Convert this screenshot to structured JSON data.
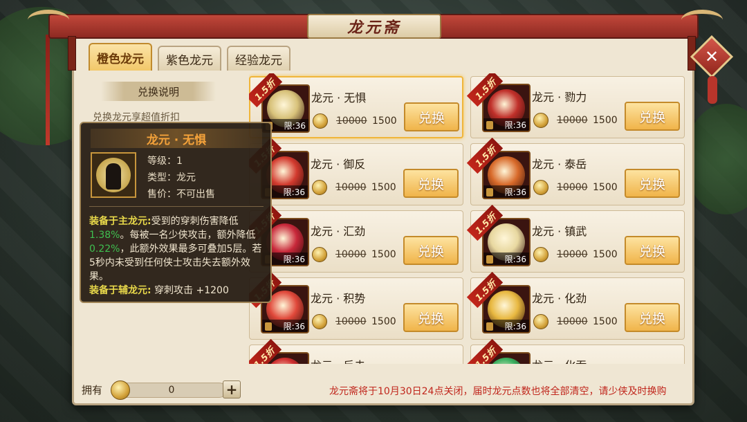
{
  "window": {
    "title": "龙元斋"
  },
  "tabs": [
    {
      "label": "橙色龙元",
      "active": true
    },
    {
      "label": "紫色龙元",
      "active": false
    },
    {
      "label": "经验龙元",
      "active": false
    }
  ],
  "explain": {
    "heading": "兑换说明",
    "text": "兑换龙元享超值折扣"
  },
  "items": [
    {
      "name": "龙元 · 无惧",
      "discount": "1.5折",
      "limit": "限:36",
      "orig_price": "10000",
      "price": "1500",
      "button": "兑换",
      "orb_color": "#d8c27a"
    },
    {
      "name": "龙元 · 勠力",
      "discount": "1.5折",
      "limit": "限:36",
      "orig_price": "10000",
      "price": "1500",
      "button": "兑换",
      "orb_color": "#c0302a"
    },
    {
      "name": "龙元 · 御反",
      "discount": "1.5折",
      "limit": "限:36",
      "orig_price": "10000",
      "price": "1500",
      "button": "兑换",
      "orb_color": "#d23a2e"
    },
    {
      "name": "龙元 · 泰岳",
      "discount": "1.5折",
      "limit": "限:36",
      "orig_price": "10000",
      "price": "1500",
      "button": "兑换",
      "orb_color": "#d86a2a"
    },
    {
      "name": "龙元 · 汇劲",
      "discount": "1.5折",
      "limit": "限:36",
      "orig_price": "10000",
      "price": "1500",
      "button": "兑换",
      "orb_color": "#c8283a"
    },
    {
      "name": "龙元 · 镇武",
      "discount": "1.5折",
      "limit": "限:36",
      "orig_price": "10000",
      "price": "1500",
      "button": "兑换",
      "orb_color": "#e8d8a0"
    },
    {
      "name": "龙元 · 积势",
      "discount": "1.5折",
      "limit": "限:36",
      "orig_price": "10000",
      "price": "1500",
      "button": "兑换",
      "orb_color": "#e0483a"
    },
    {
      "name": "龙元 · 化劲",
      "discount": "1.5折",
      "limit": "限:36",
      "orig_price": "10000",
      "price": "1500",
      "button": "兑换",
      "orb_color": "#e8b840"
    },
    {
      "name": "龙元 · 反击",
      "discount": "1.5折",
      "limit": "",
      "orig_price": "",
      "price": "",
      "button": "",
      "orb_color": "#d03030"
    },
    {
      "name": "龙元 · 化吞",
      "discount": "1.5折",
      "limit": "",
      "orig_price": "",
      "price": "",
      "button": "",
      "orb_color": "#3ab060"
    }
  ],
  "tooltip": {
    "title": "龙元 · 无惧",
    "level": "等级：1",
    "type": "类型：龙元",
    "sell": "售价：不可出售",
    "main_label": "装备于主龙元:",
    "main_text_1": "受到的穿刺伤害降低",
    "main_val_1": "1.38%",
    "main_text_2": "。每被一名少侠攻击，额外降低",
    "main_val_2": "0.22%",
    "main_text_3": "，此额外效果最多可叠加5层。若5秒内未受到任何侠士攻击失去额外效果。",
    "aux_label": "装备于辅龙元:",
    "aux_text": "穿刺攻击 +1200"
  },
  "footer": {
    "own_label": "拥有",
    "own_value": "0",
    "plus": "+",
    "notice": "龙元斋将于10月30日24点关闭，届时龙元点数也将全部清空，请少侠及时换购"
  },
  "close_label": "✕",
  "accent_colors": {
    "title": "#6b2418",
    "buy_button": "#f0b44a",
    "notice": "#c0261c",
    "tooltip_title": "#f4a23a"
  }
}
